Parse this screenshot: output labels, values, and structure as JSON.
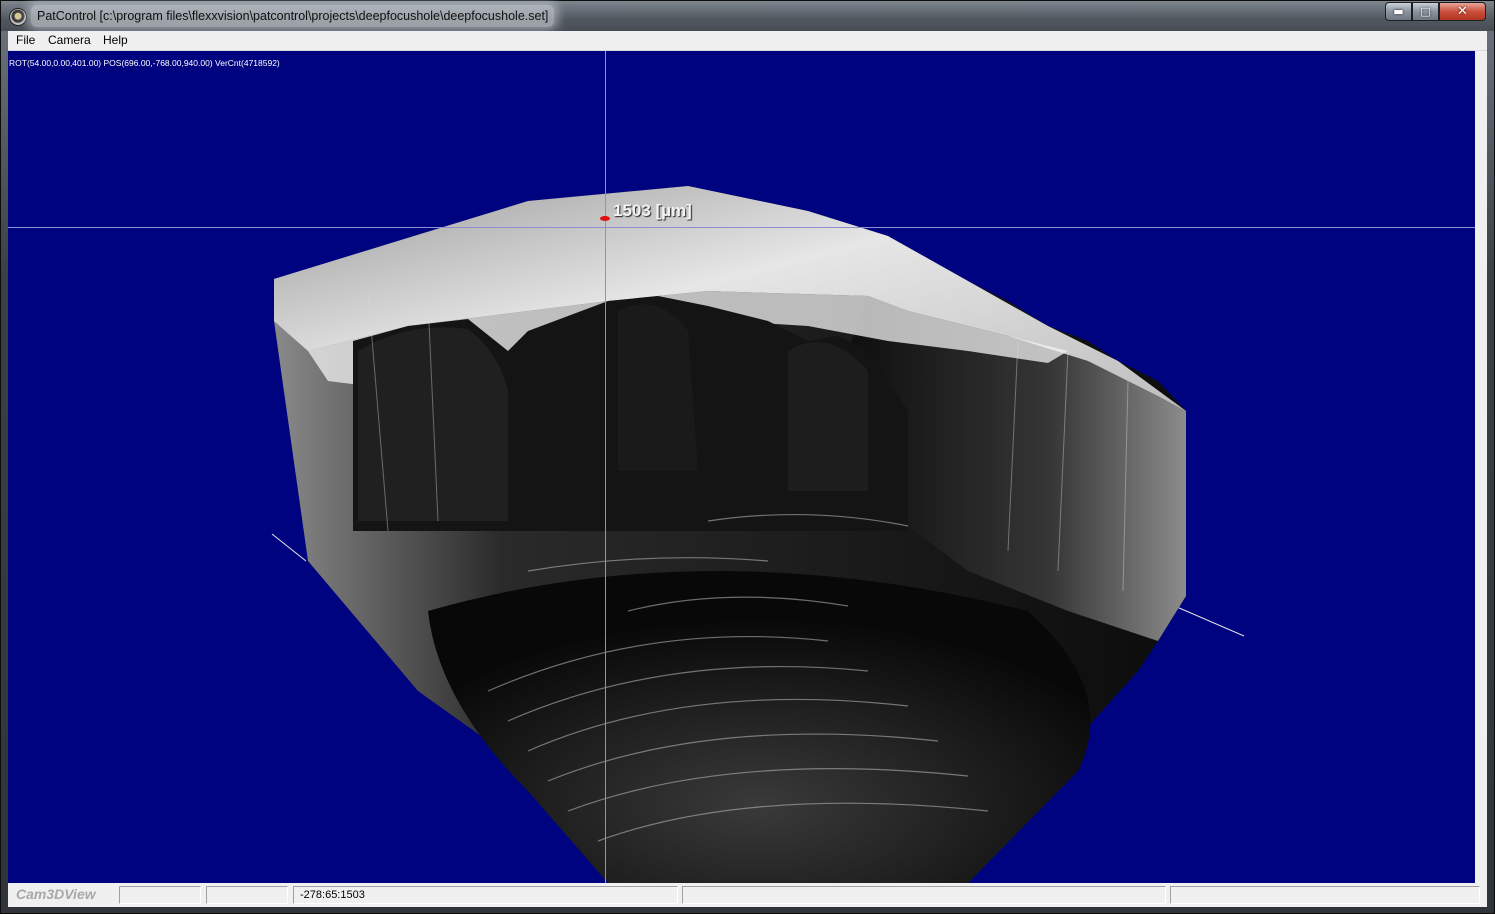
{
  "window": {
    "title": "PatControl [c:\\program files\\flexxvision\\patcontrol\\projects\\deepfocushole\\deepfocushole.set]",
    "icon": "app-icon",
    "controls": [
      "minimize-icon",
      "maximize-icon",
      "close-icon"
    ]
  },
  "menu": {
    "items": [
      "File",
      "Camera",
      "Help"
    ]
  },
  "viewport": {
    "hud_text": "ROT(54.00,0.00,401.00) POS(696.00,-768.00,940.00) VerCnt(4718592)",
    "height_label": "1503 [µm]",
    "background_color": "#00037f",
    "crosshair_color": "#8d8fcf",
    "marker_color": "#e01010"
  },
  "statusbar": {
    "brand": "Cam3DView",
    "panels": [
      "",
      "",
      "-278:65:1503",
      "",
      ""
    ]
  }
}
